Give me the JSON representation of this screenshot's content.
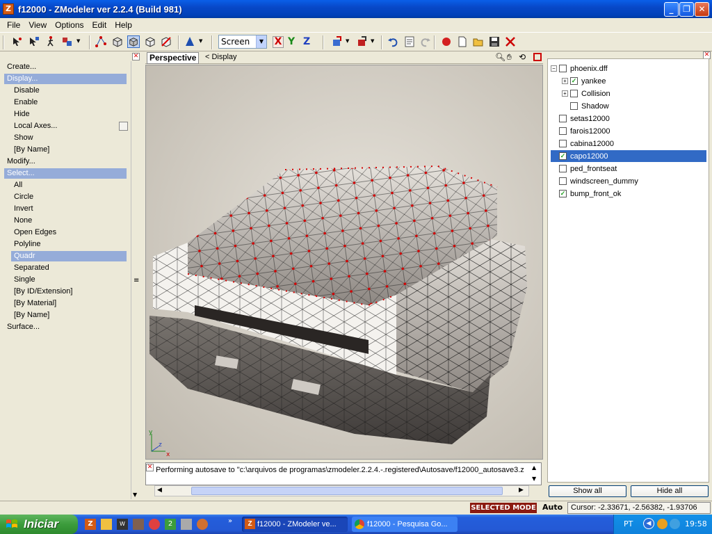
{
  "window": {
    "title": "f12000 - ZModeler ver 2.2.4 (Build 981)",
    "icon_letter": "Z"
  },
  "menu": [
    "File",
    "View",
    "Options",
    "Edit",
    "Help"
  ],
  "toolbar": {
    "axis_select": "Screen",
    "axis_x": "X",
    "axis_y": "Y",
    "axis_z": "Z"
  },
  "left_panel": {
    "items": [
      {
        "label": "Create...",
        "level": 0,
        "selected": false
      },
      {
        "label": "Display...",
        "level": 0,
        "selected": true
      },
      {
        "label": "Disable",
        "level": 1,
        "selected": false
      },
      {
        "label": "Enable",
        "level": 1,
        "selected": false
      },
      {
        "label": "Hide",
        "level": 1,
        "selected": false
      },
      {
        "label": "Local Axes...",
        "level": 1,
        "selected": false
      },
      {
        "label": "Show",
        "level": 1,
        "selected": false
      },
      {
        "label": "[By Name]",
        "level": 1,
        "selected": false
      },
      {
        "label": "Modify...",
        "level": 0,
        "selected": false
      },
      {
        "label": "Select...",
        "level": 0,
        "selected": true
      },
      {
        "label": "All",
        "level": 1,
        "selected": false
      },
      {
        "label": "Circle",
        "level": 1,
        "selected": false
      },
      {
        "label": "Invert",
        "level": 1,
        "selected": false
      },
      {
        "label": "None",
        "level": 1,
        "selected": false
      },
      {
        "label": "Open Edges",
        "level": 1,
        "selected": false
      },
      {
        "label": "Polyline",
        "level": 1,
        "selected": false
      },
      {
        "label": "Quadr",
        "level": 1,
        "selected": true
      },
      {
        "label": "Separated",
        "level": 1,
        "selected": false
      },
      {
        "label": "Single",
        "level": 1,
        "selected": false
      },
      {
        "label": "[By ID/Extension]",
        "level": 1,
        "selected": false
      },
      {
        "label": "[By Material]",
        "level": 1,
        "selected": false
      },
      {
        "label": "[By Name]",
        "level": 1,
        "selected": false
      },
      {
        "label": "Surface...",
        "level": 0,
        "selected": false
      }
    ]
  },
  "viewport": {
    "tab": "Perspective",
    "breadcrumb": "< Display",
    "axis_y": "y",
    "axis_z": "z",
    "axis_x": "x"
  },
  "log": {
    "text": "Performing autosave to \"c:\\arquivos de programas\\zmodeler.2.2.4.-.registered\\Autosave/f12000_autosave3.z"
  },
  "tree": {
    "items": [
      {
        "label": "phoenix.dff",
        "checked": false,
        "expand": "−",
        "indent": 0,
        "selected": false
      },
      {
        "label": "yankee",
        "checked": true,
        "expand": "+",
        "indent": 1,
        "selected": false
      },
      {
        "label": "Collision",
        "checked": false,
        "expand": "+",
        "indent": 1,
        "selected": false
      },
      {
        "label": "Shadow",
        "checked": false,
        "expand": "",
        "indent": 1,
        "selected": false
      },
      {
        "label": "setas12000",
        "checked": false,
        "expand": "",
        "indent": 0,
        "selected": false
      },
      {
        "label": "farois12000",
        "checked": false,
        "expand": "",
        "indent": 0,
        "selected": false
      },
      {
        "label": "cabina12000",
        "checked": false,
        "expand": "",
        "indent": 0,
        "selected": false
      },
      {
        "label": "capo12000",
        "checked": true,
        "expand": "",
        "indent": 0,
        "selected": true
      },
      {
        "label": "ped_frontseat",
        "checked": false,
        "expand": "",
        "indent": 0,
        "selected": false
      },
      {
        "label": "windscreen_dummy",
        "checked": false,
        "expand": "",
        "indent": 0,
        "selected": false
      },
      {
        "label": "bump_front_ok",
        "checked": true,
        "expand": "",
        "indent": 0,
        "selected": false
      }
    ],
    "show_all": "Show all",
    "hide_all": "Hide all"
  },
  "status": {
    "mode": "SELECTED MODE",
    "auto": "Auto",
    "cursor": "Cursor: -2.33671, -2.56382, -1.93706"
  },
  "taskbar": {
    "start": "Iniciar",
    "tasks": [
      {
        "label": "f12000 - ZModeler ve...",
        "active": true
      },
      {
        "label": "f12000 - Pesquisa Go...",
        "active": false
      }
    ],
    "lang": "PT",
    "clock": "19:58"
  },
  "colors": {
    "selection": "#316ac5",
    "vertex": "#d40000",
    "mode_badge": "#8b1a10"
  }
}
